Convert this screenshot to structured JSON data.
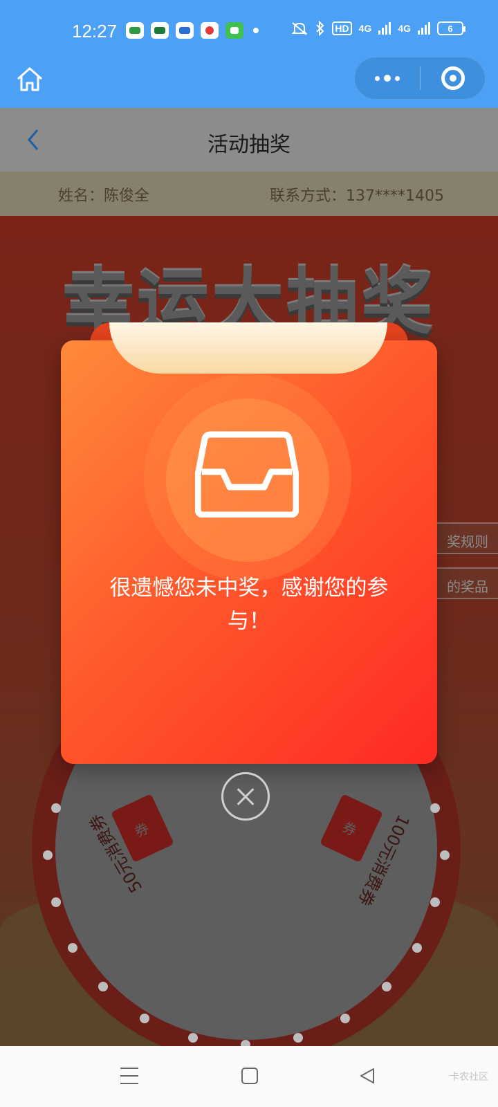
{
  "status_bar": {
    "time": "12:27",
    "hd_label": "HD",
    "net1": "4G",
    "net2": "4G",
    "battery": "6"
  },
  "page": {
    "title": "活动抽奖",
    "name_label": "姓名：陈俊全",
    "contact_label": "联系方式：137****1405"
  },
  "game": {
    "hero_title": "幸运大抽奖",
    "side_tab_rules": "奖规则",
    "side_tab_prizes": "的奖品",
    "prize_left": "50元消费券",
    "prize_right": "100元消费券",
    "ticket_char": "券"
  },
  "modal": {
    "message": "很遗憾您未中奖，感谢您的参与！"
  },
  "nav": {
    "watermark": "卡农社区"
  },
  "colors": {
    "status_blue": "#4ca0f5",
    "modal_orange": "#ff8a3a",
    "modal_red": "#ff2a24"
  }
}
